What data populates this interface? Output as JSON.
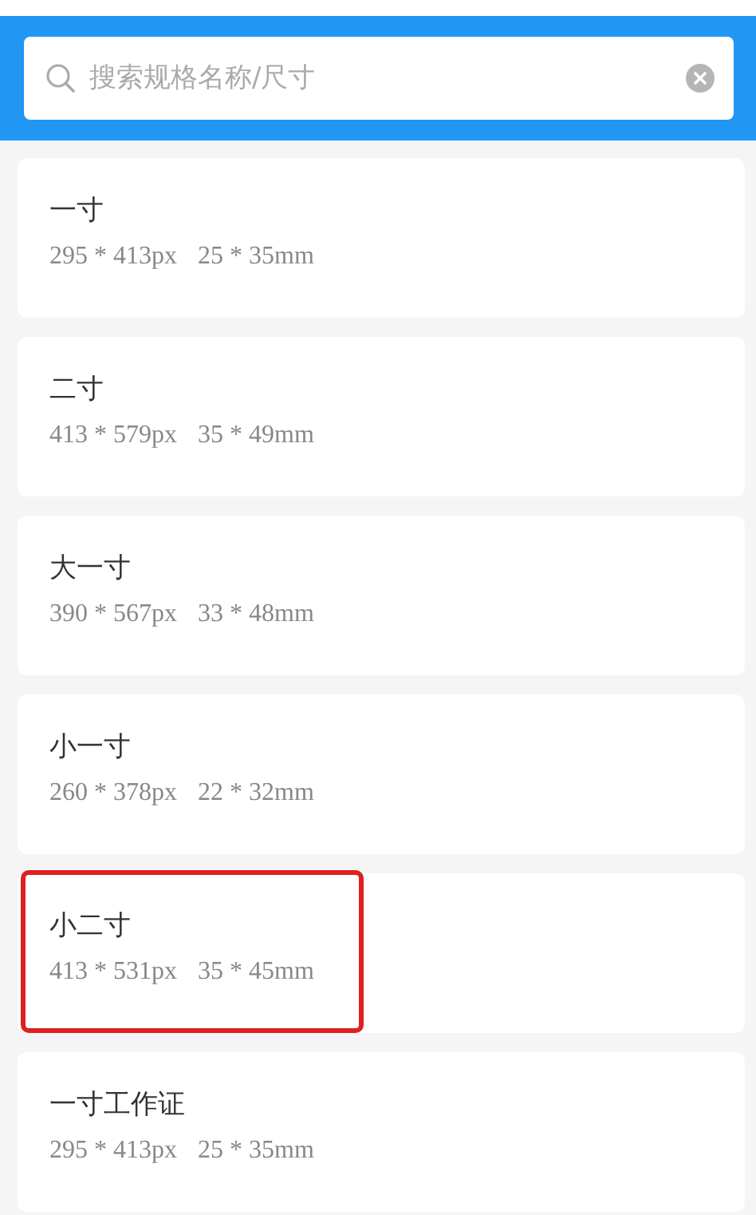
{
  "search": {
    "placeholder": "搜索规格名称/尺寸"
  },
  "items": [
    {
      "name": "一寸",
      "pixels": "295 * 413px",
      "size": "25 * 35mm",
      "highlighted": false
    },
    {
      "name": "二寸",
      "pixels": "413 * 579px",
      "size": "35 * 49mm",
      "highlighted": false
    },
    {
      "name": "大一寸",
      "pixels": "390 * 567px",
      "size": "33 * 48mm",
      "highlighted": false
    },
    {
      "name": "小一寸",
      "pixels": "260 * 378px",
      "size": "22 * 32mm",
      "highlighted": false
    },
    {
      "name": "小二寸",
      "pixels": "413 * 531px",
      "size": "35 * 45mm",
      "highlighted": true
    },
    {
      "name": "一寸工作证",
      "pixels": "295 * 413px",
      "size": "25 * 35mm",
      "highlighted": false
    }
  ]
}
